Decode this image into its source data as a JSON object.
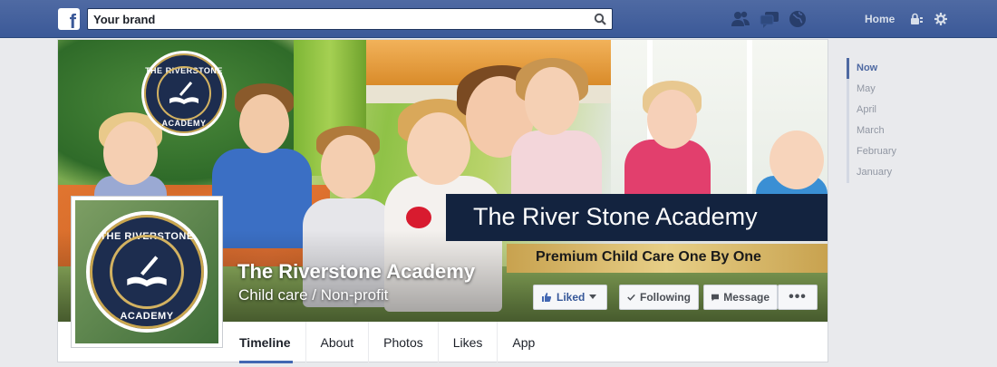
{
  "topbar": {
    "search_value": "Your brand",
    "home_label": "Home",
    "icons": [
      "facebook-logo-icon",
      "search-icon",
      "friends-icon",
      "messages-icon",
      "notifications-globe-icon",
      "privacy-lock-icon",
      "settings-gear-icon"
    ]
  },
  "cover": {
    "logo_text_top": "THE RIVERSTONE",
    "logo_text_bottom": "ACADEMY",
    "banner_title": "The River Stone Academy",
    "banner_subtitle": "Premium Child Care One By One"
  },
  "page": {
    "name": "The Riverstone Academy",
    "category": "Child care / Non-profit"
  },
  "profile": {
    "badge_text_top": "THE RIVERSTONE",
    "badge_text_bottom": "ACADEMY"
  },
  "actions": {
    "liked": "Liked",
    "following": "Following",
    "message": "Message",
    "more": "•••"
  },
  "tabs": [
    "Timeline",
    "About",
    "Photos",
    "Likes",
    "App"
  ],
  "timeline": [
    "Now",
    "May",
    "April",
    "March",
    "February",
    "January"
  ],
  "colors": {
    "facebook_blue": "#3b5998",
    "banner_navy": "#13233f",
    "gold": "#c8a24f"
  }
}
